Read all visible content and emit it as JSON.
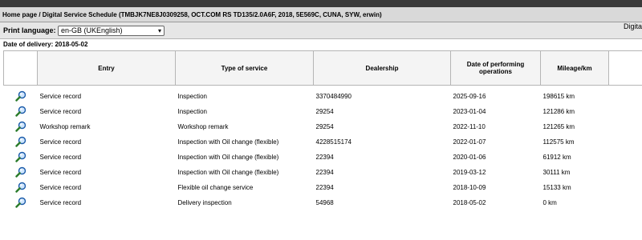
{
  "breadcrumb": "Home page / Digital Service Schedule (TMBJK7NE8J0309258, OCT.COM RS TD135/2.0A6F, 2018, 5E569C, CUNA, SYW, erwin)",
  "print_language": {
    "label": "Print language:",
    "selected": "en-GB (UKEnglish)",
    "right_text": "Digita"
  },
  "delivery": "Date of delivery: 2018-05-02",
  "table": {
    "headers": {
      "entry": "Entry",
      "type": "Type of service",
      "dealership": "Dealership",
      "date": "Date of performing operations",
      "mileage": "Mileage/km"
    },
    "rows": [
      {
        "icon": "magnifier-icon",
        "entry": "Service record",
        "type": "Inspection",
        "dealership": "3370484990",
        "date": "2025-09-16",
        "mileage": "198615 km"
      },
      {
        "icon": "magnifier-icon",
        "entry": "Service record",
        "type": "Inspection",
        "dealership": "29254",
        "date": "2023-01-04",
        "mileage": "121286 km"
      },
      {
        "icon": "magnifier-icon",
        "entry": "Workshop remark",
        "type": "Workshop remark",
        "dealership": "29254",
        "date": "2022-11-10",
        "mileage": "121265 km"
      },
      {
        "icon": "magnifier-icon",
        "entry": "Service record",
        "type": "Inspection with Oil change (flexible)",
        "dealership": "4228515174",
        "date": "2022-01-07",
        "mileage": "112575 km"
      },
      {
        "icon": "magnifier-icon",
        "entry": "Service record",
        "type": "Inspection with Oil change (flexible)",
        "dealership": "22394",
        "date": "2020-01-06",
        "mileage": "61912 km"
      },
      {
        "icon": "magnifier-icon",
        "entry": "Service record",
        "type": "Inspection with Oil change (flexible)",
        "dealership": "22394",
        "date": "2019-03-12",
        "mileage": "30111 km"
      },
      {
        "icon": "magnifier-icon",
        "entry": "Service record",
        "type": "Flexible oil change service",
        "dealership": "22394",
        "date": "2018-10-09",
        "mileage": "15133 km"
      },
      {
        "icon": "magnifier-icon",
        "entry": "Service record",
        "type": "Delivery inspection",
        "dealership": "54968",
        "date": "2018-05-02",
        "mileage": "0 km"
      }
    ]
  }
}
